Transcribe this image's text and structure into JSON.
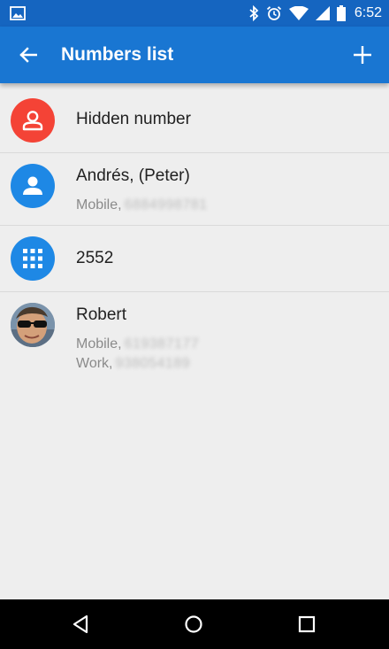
{
  "status_bar": {
    "time": "6:52",
    "icons": [
      "picture-icon",
      "bluetooth-icon",
      "alarm-icon",
      "wifi-icon",
      "signal-icon",
      "battery-icon"
    ]
  },
  "app_bar": {
    "title": "Numbers list",
    "back_icon": "arrow-back-icon",
    "add_icon": "plus-icon",
    "color": "#1976d2"
  },
  "contacts": [
    {
      "name": "Hidden number",
      "avatar": "person-outline-icon",
      "avatar_color": "#f44336",
      "numbers": []
    },
    {
      "name": "Andrés, (Peter)",
      "avatar": "person-icon",
      "avatar_color": "#1e88e5",
      "numbers": [
        {
          "label": "Mobile,",
          "value": "6884998781"
        }
      ]
    },
    {
      "name": "2552",
      "avatar": "dialpad-icon",
      "avatar_color": "#1e88e5",
      "numbers": []
    },
    {
      "name": "Robert",
      "avatar": "photo-avatar",
      "numbers": [
        {
          "label": "Mobile,",
          "value": "619387177"
        },
        {
          "label": "Work,",
          "value": "938054189"
        }
      ]
    }
  ],
  "nav_bar": {
    "icons": [
      "nav-back-icon",
      "nav-home-icon",
      "nav-recents-icon"
    ]
  }
}
